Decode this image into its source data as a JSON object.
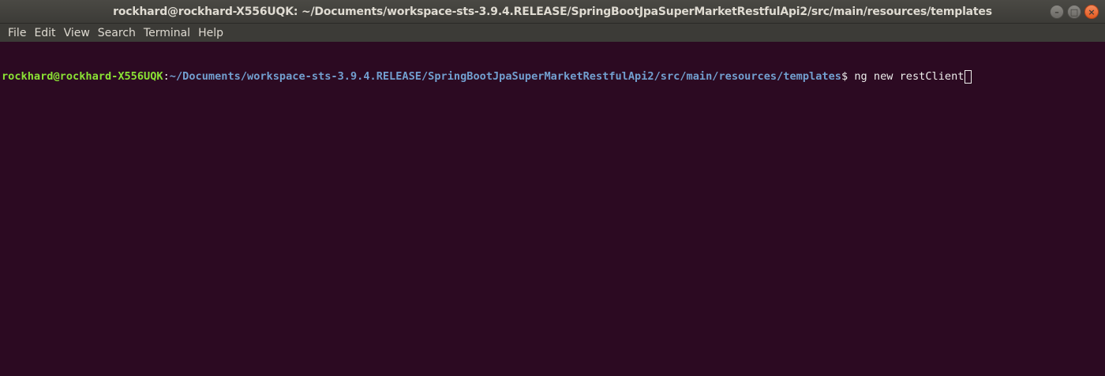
{
  "window": {
    "title": "rockhard@rockhard-X556UQK: ~/Documents/workspace-sts-3.9.4.RELEASE/SpringBootJpaSuperMarketRestfulApi2/src/main/resources/templates",
    "controls": {
      "minimize": "–",
      "maximize": "□",
      "close": "×"
    }
  },
  "menu": {
    "items": [
      "File",
      "Edit",
      "View",
      "Search",
      "Terminal",
      "Help"
    ]
  },
  "terminal": {
    "user_host": "rockhard@rockhard-X556UQK",
    "colon": ":",
    "path": "~/Documents/workspace-sts-3.9.4.RELEASE/SpringBootJpaSuperMarketRestfulApi2/src/main/resources/templates",
    "dollar": "$ ",
    "command": "ng new restClient"
  },
  "colors": {
    "background": "#2c0a22",
    "user": "#8ae234",
    "path": "#729fcf",
    "text": "#eeeeec"
  }
}
